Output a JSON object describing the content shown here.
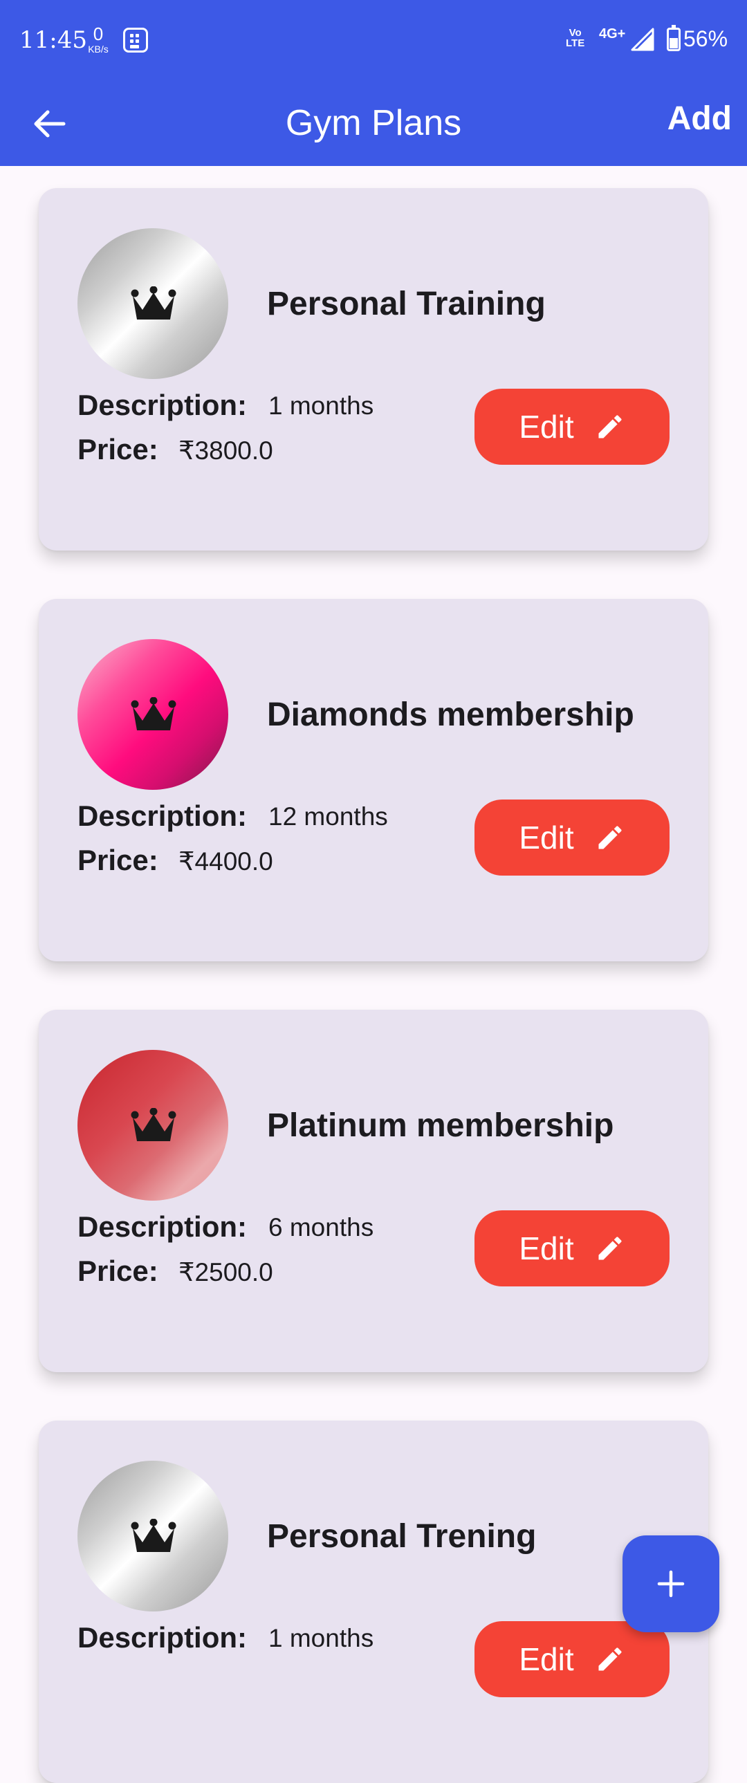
{
  "status_bar": {
    "time": "11:45",
    "net_speed_value": "0",
    "net_speed_unit": "KB/s",
    "volte_top": "Vo",
    "volte_bottom": "LTE",
    "network": "4G+",
    "battery_percent": "56%",
    "battery_level": 0.56
  },
  "app_bar": {
    "title": "Gym Plans",
    "add_label": "Add",
    "color": "#3d59e6"
  },
  "labels": {
    "description": "Description:",
    "price": "Price:",
    "edit": "Edit"
  },
  "plans": [
    {
      "name": "Personal Training",
      "description": "1 months",
      "price": "₹3800.0",
      "icon": "crown-icon",
      "badge_style": "silver"
    },
    {
      "name": "Diamonds membership",
      "description": "12 months",
      "price": "₹4400.0",
      "icon": "crown-icon",
      "badge_style": "pink"
    },
    {
      "name": "Platinum membership",
      "description": "6 months",
      "price": "₹2500.0",
      "icon": "crown-icon",
      "badge_style": "red"
    },
    {
      "name": "Personal Trening",
      "description": "1 months",
      "price": "",
      "icon": "crown-icon",
      "badge_style": "silver"
    }
  ],
  "colors": {
    "primary": "#3d59e6",
    "edit_button": "#f44336",
    "card_background": "#e8e2f0"
  },
  "fab": {
    "icon": "plus-icon"
  }
}
